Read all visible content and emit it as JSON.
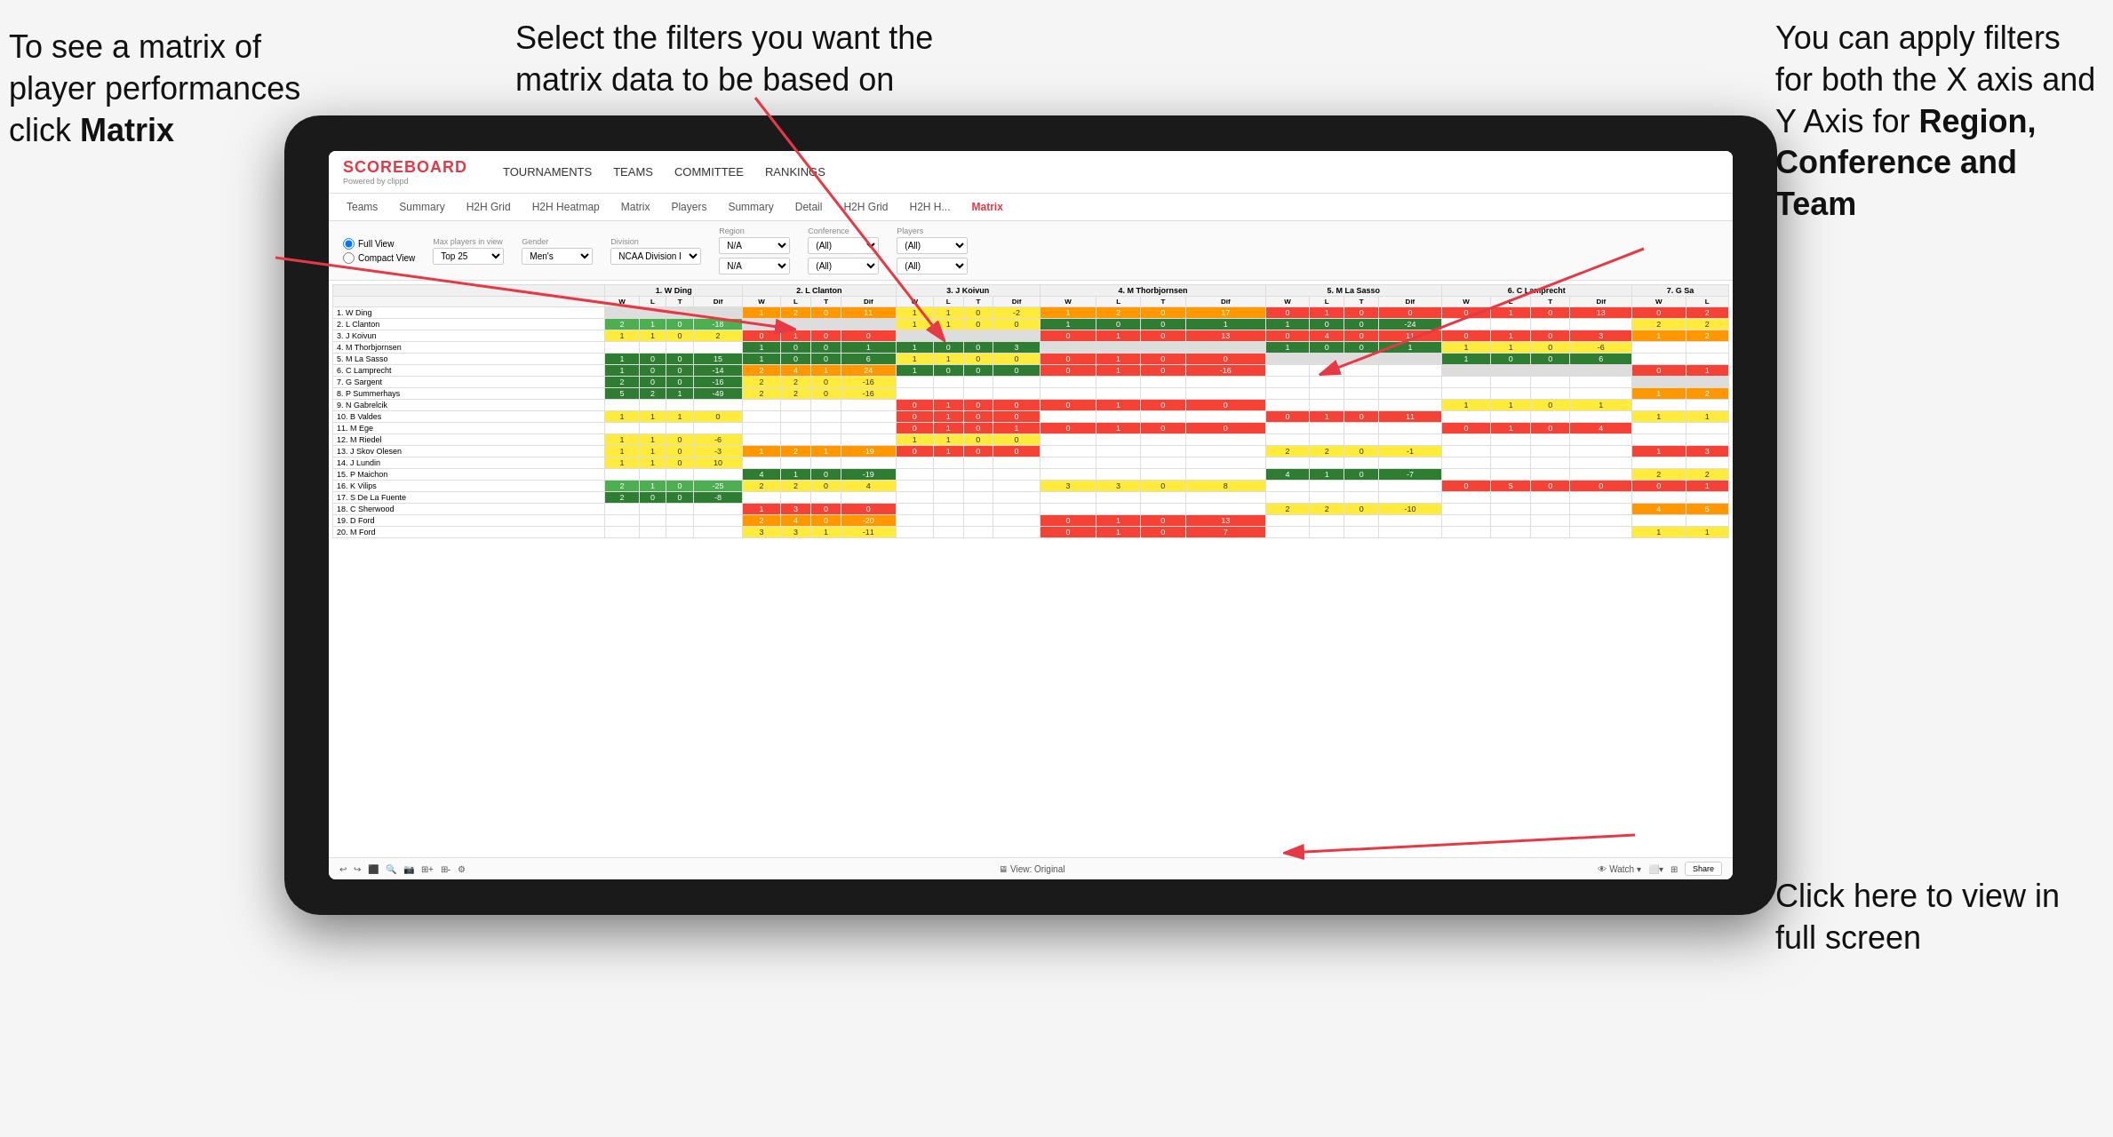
{
  "annotations": {
    "topleft": {
      "line1": "To see a matrix of",
      "line2": "player performances",
      "line3_prefix": "click ",
      "line3_bold": "Matrix"
    },
    "topmid": {
      "text": "Select the filters you want the matrix data to be based on"
    },
    "topright": {
      "line1": "You  can apply",
      "line2": "filters for both",
      "line3": "the X axis and Y",
      "line4_prefix": "Axis for ",
      "line4_bold": "Region,",
      "line5_bold": "Conference and",
      "line6_bold": "Team"
    },
    "bottomright": {
      "line1": "Click here to view",
      "line2": "in full screen"
    }
  },
  "nav": {
    "logo": "SCOREBOARD",
    "logo_sub": "Powered by clippd",
    "items": [
      "TOURNAMENTS",
      "TEAMS",
      "COMMITTEE",
      "RANKINGS"
    ]
  },
  "subnav": {
    "items": [
      "Teams",
      "Summary",
      "H2H Grid",
      "H2H Heatmap",
      "Matrix",
      "Players",
      "Summary",
      "Detail",
      "H2H Grid",
      "H2H H...",
      "Matrix"
    ],
    "active": "Matrix"
  },
  "filters": {
    "view_options": [
      "Full View",
      "Compact View"
    ],
    "max_players_label": "Max players in view",
    "max_players_value": "Top 25",
    "gender_label": "Gender",
    "gender_value": "Men's",
    "division_label": "Division",
    "division_value": "NCAA Division I",
    "region_label": "Region",
    "region_value": "N/A",
    "conference_label": "Conference",
    "conference_value": "(All)",
    "players_label": "Players",
    "players_value": "(All)"
  },
  "matrix": {
    "col_headers": [
      "1. W Ding",
      "2. L Clanton",
      "3. J Koivun",
      "4. M Thorbjornsen",
      "5. M La Sasso",
      "6. C Lamprecht",
      "7. G Sa"
    ],
    "wlt_cols": [
      "W",
      "L",
      "T",
      "Dif"
    ],
    "rows": [
      {
        "name": "1. W Ding",
        "data": [
          [
            null,
            null,
            null,
            null
          ],
          [
            1,
            2,
            0,
            11
          ],
          [
            1,
            1,
            0,
            -2
          ],
          [
            1,
            2,
            0,
            17
          ],
          [
            0,
            1,
            0,
            0
          ],
          [
            0,
            1,
            0,
            13
          ],
          [
            0,
            2
          ]
        ]
      },
      {
        "name": "2. L Clanton",
        "data": [
          [
            2,
            1,
            0,
            -18
          ],
          [
            null,
            null,
            null,
            null
          ],
          [
            1,
            1,
            0,
            0
          ],
          [
            1,
            0,
            0,
            1
          ],
          [
            1,
            0,
            0,
            -24
          ],
          [
            null,
            null,
            null,
            null
          ],
          [
            2,
            2
          ]
        ]
      },
      {
        "name": "3. J Koivun",
        "data": [
          [
            1,
            1,
            0,
            2
          ],
          [
            0,
            1,
            0,
            0
          ],
          [
            null,
            null,
            null,
            null
          ],
          [
            0,
            1,
            0,
            13
          ],
          [
            0,
            4,
            0,
            11
          ],
          [
            0,
            1,
            0,
            3
          ],
          [
            1,
            2
          ]
        ]
      },
      {
        "name": "4. M Thorbjornsen",
        "data": [
          [
            null,
            null,
            null,
            null
          ],
          [
            1,
            0,
            0,
            1
          ],
          [
            1,
            0,
            0,
            3
          ],
          [
            null,
            null,
            null,
            null
          ],
          [
            1,
            0,
            0,
            1
          ],
          [
            1,
            1,
            0,
            -6
          ],
          [
            null,
            null
          ]
        ]
      },
      {
        "name": "5. M La Sasso",
        "data": [
          [
            1,
            0,
            0,
            15
          ],
          [
            1,
            0,
            0,
            6
          ],
          [
            1,
            1,
            0,
            0
          ],
          [
            0,
            1,
            0,
            0
          ],
          [
            null,
            null,
            null,
            null
          ],
          [
            1,
            0,
            0,
            6
          ],
          [
            null,
            null
          ]
        ]
      },
      {
        "name": "6. C Lamprecht",
        "data": [
          [
            1,
            0,
            0,
            -14
          ],
          [
            2,
            4,
            1,
            24
          ],
          [
            1,
            0,
            0,
            0
          ],
          [
            0,
            1,
            0,
            -16
          ],
          [
            null,
            null,
            null,
            null
          ],
          [
            null,
            null,
            null,
            null
          ],
          [
            0,
            1
          ]
        ]
      },
      {
        "name": "7. G Sargent",
        "data": [
          [
            2,
            0,
            0,
            -16
          ],
          [
            2,
            2,
            0,
            -16
          ],
          [
            null,
            null,
            null,
            null
          ],
          [
            null,
            null,
            null,
            null
          ],
          [
            null,
            null,
            null,
            null
          ],
          [
            null,
            null,
            null,
            null
          ],
          [
            null,
            null
          ]
        ]
      },
      {
        "name": "8. P Summerhays",
        "data": [
          [
            5,
            2,
            1,
            -49
          ],
          [
            2,
            2,
            0,
            -16
          ],
          [
            null,
            null,
            null,
            null
          ],
          [
            null,
            null,
            null,
            null
          ],
          [
            null,
            null,
            null,
            null
          ],
          [
            null,
            null,
            null,
            null
          ],
          [
            1,
            2
          ]
        ]
      },
      {
        "name": "9. N Gabrelcik",
        "data": [
          [
            null,
            null,
            null,
            null
          ],
          [
            null,
            null,
            null,
            null
          ],
          [
            0,
            1,
            0,
            0
          ],
          [
            0,
            1,
            0,
            0
          ],
          [
            null,
            null,
            null,
            null
          ],
          [
            1,
            1,
            0,
            1
          ],
          [
            null,
            null
          ]
        ]
      },
      {
        "name": "10. B Valdes",
        "data": [
          [
            1,
            1,
            1,
            0
          ],
          [
            null,
            null,
            null,
            null
          ],
          [
            0,
            1,
            0,
            0
          ],
          [
            null,
            null,
            null,
            null
          ],
          [
            0,
            1,
            0,
            11
          ],
          [
            null,
            null,
            null,
            null
          ],
          [
            1,
            1
          ]
        ]
      },
      {
        "name": "11. M Ege",
        "data": [
          [
            null,
            null,
            null,
            null
          ],
          [
            null,
            null,
            null,
            null
          ],
          [
            0,
            1,
            0,
            1
          ],
          [
            0,
            1,
            0,
            0
          ],
          [
            null,
            null,
            null,
            null
          ],
          [
            0,
            1,
            0,
            4
          ],
          [
            null,
            null
          ]
        ]
      },
      {
        "name": "12. M Riedel",
        "data": [
          [
            1,
            1,
            0,
            -6
          ],
          [
            null,
            null,
            null,
            null
          ],
          [
            1,
            1,
            0,
            0
          ],
          [
            null,
            null,
            null,
            null
          ],
          [
            null,
            null,
            null,
            null
          ],
          [
            null,
            null,
            null,
            null
          ],
          [
            null,
            null
          ]
        ]
      },
      {
        "name": "13. J Skov Olesen",
        "data": [
          [
            1,
            1,
            0,
            -3
          ],
          [
            1,
            2,
            1,
            -19
          ],
          [
            0,
            1,
            0,
            0
          ],
          [
            null,
            null,
            null,
            null
          ],
          [
            2,
            2,
            0,
            -1
          ],
          [
            null,
            null,
            null,
            null
          ],
          [
            1,
            3
          ]
        ]
      },
      {
        "name": "14. J Lundin",
        "data": [
          [
            1,
            1,
            0,
            10
          ],
          [
            null,
            null,
            null,
            null
          ],
          [
            null,
            null,
            null,
            null
          ],
          [
            null,
            null,
            null,
            null
          ],
          [
            null,
            null,
            null,
            null
          ],
          [
            null,
            null,
            null,
            null
          ],
          [
            null,
            null
          ]
        ]
      },
      {
        "name": "15. P Maichon",
        "data": [
          [
            null,
            null,
            null,
            null
          ],
          [
            4,
            1,
            0,
            -19
          ],
          [
            null,
            null,
            null,
            null
          ],
          [
            null,
            null,
            null,
            null
          ],
          [
            4,
            1,
            0,
            -7
          ],
          [
            null,
            null,
            null,
            null
          ],
          [
            2,
            2
          ]
        ]
      },
      {
        "name": "16. K Vilips",
        "data": [
          [
            2,
            1,
            0,
            -25
          ],
          [
            2,
            2,
            0,
            4
          ],
          [
            null,
            null,
            null,
            null
          ],
          [
            3,
            3,
            0,
            8
          ],
          [
            null,
            null,
            null,
            null
          ],
          [
            0,
            5,
            0,
            0
          ],
          [
            0,
            1
          ]
        ]
      },
      {
        "name": "17. S De La Fuente",
        "data": [
          [
            2,
            0,
            0,
            -8
          ],
          [
            null,
            null,
            null,
            null
          ],
          [
            null,
            null,
            null,
            null
          ],
          [
            null,
            null,
            null,
            null
          ],
          [
            null,
            null,
            null,
            null
          ],
          [
            null,
            null,
            null,
            null
          ],
          [
            null,
            null
          ]
        ]
      },
      {
        "name": "18. C Sherwood",
        "data": [
          [
            null,
            null,
            null,
            null
          ],
          [
            1,
            3,
            0,
            0
          ],
          [
            null,
            null,
            null,
            null
          ],
          [
            null,
            null,
            null,
            null
          ],
          [
            2,
            2,
            0,
            -10
          ],
          [
            null,
            null,
            null,
            null
          ],
          [
            4,
            5
          ]
        ]
      },
      {
        "name": "19. D Ford",
        "data": [
          [
            null,
            null,
            null,
            null
          ],
          [
            2,
            4,
            0,
            -20
          ],
          [
            null,
            null,
            null,
            null
          ],
          [
            0,
            1,
            0,
            13
          ],
          [
            null,
            null,
            null,
            null
          ],
          [
            null,
            null,
            null,
            null
          ],
          [
            null,
            null
          ]
        ]
      },
      {
        "name": "20. M Ford",
        "data": [
          [
            null,
            null,
            null,
            null
          ],
          [
            3,
            3,
            1,
            -11
          ],
          [
            null,
            null,
            null,
            null
          ],
          [
            0,
            1,
            0,
            7
          ],
          [
            null,
            null,
            null,
            null
          ],
          [
            null,
            null,
            null,
            null
          ],
          [
            1,
            1
          ]
        ]
      }
    ]
  },
  "toolbar": {
    "left_items": [
      "↩",
      "↪",
      "⬛",
      "🔍",
      "📷",
      "⬛+",
      "⬛-",
      "⚙"
    ],
    "mid_text": "View: Original",
    "watch_btn": "Watch ▾",
    "share_btn": "Share"
  },
  "colors": {
    "accent": "#e63946",
    "green": "#4caf50",
    "yellow": "#ffeb3b",
    "orange": "#ff9800"
  }
}
